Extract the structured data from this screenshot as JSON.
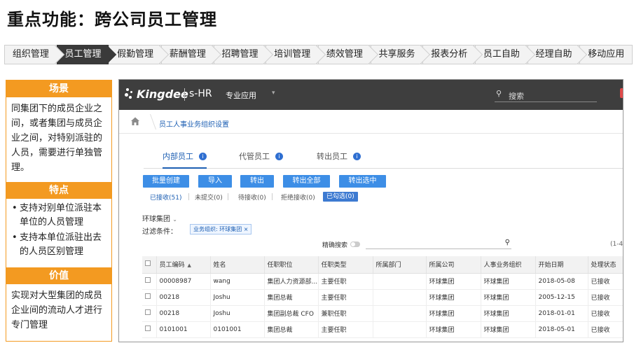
{
  "page_title": "重点功能：跨公司员工管理",
  "nav": {
    "items": [
      "组织管理",
      "员工管理",
      "假勤管理",
      "薪酬管理",
      "招聘管理",
      "培训管理",
      "绩效管理",
      "共享服务",
      "报表分析",
      "员工自助",
      "经理自助",
      "移动应用"
    ],
    "active_index": 1
  },
  "left_panel": {
    "scene_title": "场景",
    "scene_text": "同集团下的成员企业之间，或者集团与成员企业之间，对特别派驻的人员，需要进行单独管理。",
    "feature_title": "特点",
    "features": [
      "支持对别单位派驻本单位的人员管理",
      "支持本单位派驻出去的人员区别管理"
    ],
    "value_title": "价值",
    "value_text": "实现对大型集团的成员企业间的流动人才进行专门管理",
    "accent_color": "#f39a21"
  },
  "app": {
    "logo": "Kingdee",
    "product": "s-HR",
    "menu_label": "专业应用",
    "search_placeholder": "搜索",
    "breadcrumb": "员工人事业务组织设置",
    "tabs": [
      "内部员工",
      "代管员工",
      "转出员工"
    ],
    "buttons": [
      "批量创建",
      "导入",
      "转出",
      "转出全部",
      "转出选中"
    ],
    "status_filters": [
      "已接收(51)",
      "未提交(0)",
      "待接收(0)",
      "拒绝接收(0)"
    ],
    "status_active": "已勾选(0)",
    "org_label": "环球集团",
    "filter_label": "过滤条件：",
    "filter_chip": "业务组织: 环球集团 ×",
    "fuzzy_search_label": "精确搜索",
    "pager": "(1-4",
    "brand_color": "#3d8ee6",
    "table": {
      "columns": [
        "员工编码",
        "姓名",
        "任职职位",
        "任职类型",
        "所属部门",
        "所属公司",
        "人事业务组织",
        "开始日期",
        "处理状态"
      ],
      "rows": [
        [
          "00008987",
          "wang",
          "集团人力资源部...",
          "主要任职",
          "",
          "环球集团",
          "环球集团",
          "2018-05-08",
          "已接收"
        ],
        [
          "00218",
          "Joshu",
          "集团总裁",
          "主要任职",
          "",
          "环球集团",
          "环球集团",
          "2005-12-15",
          "已接收"
        ],
        [
          "00218",
          "Joshu",
          "集团副总裁 CFO",
          "兼职任职",
          "",
          "环球集团",
          "环球集团",
          "2018-01-01",
          "已接收"
        ],
        [
          "0101001",
          "0101001",
          "集团总裁",
          "主要任职",
          "",
          "环球集团",
          "环球集团",
          "2018-05-01",
          "已接收"
        ]
      ]
    }
  }
}
